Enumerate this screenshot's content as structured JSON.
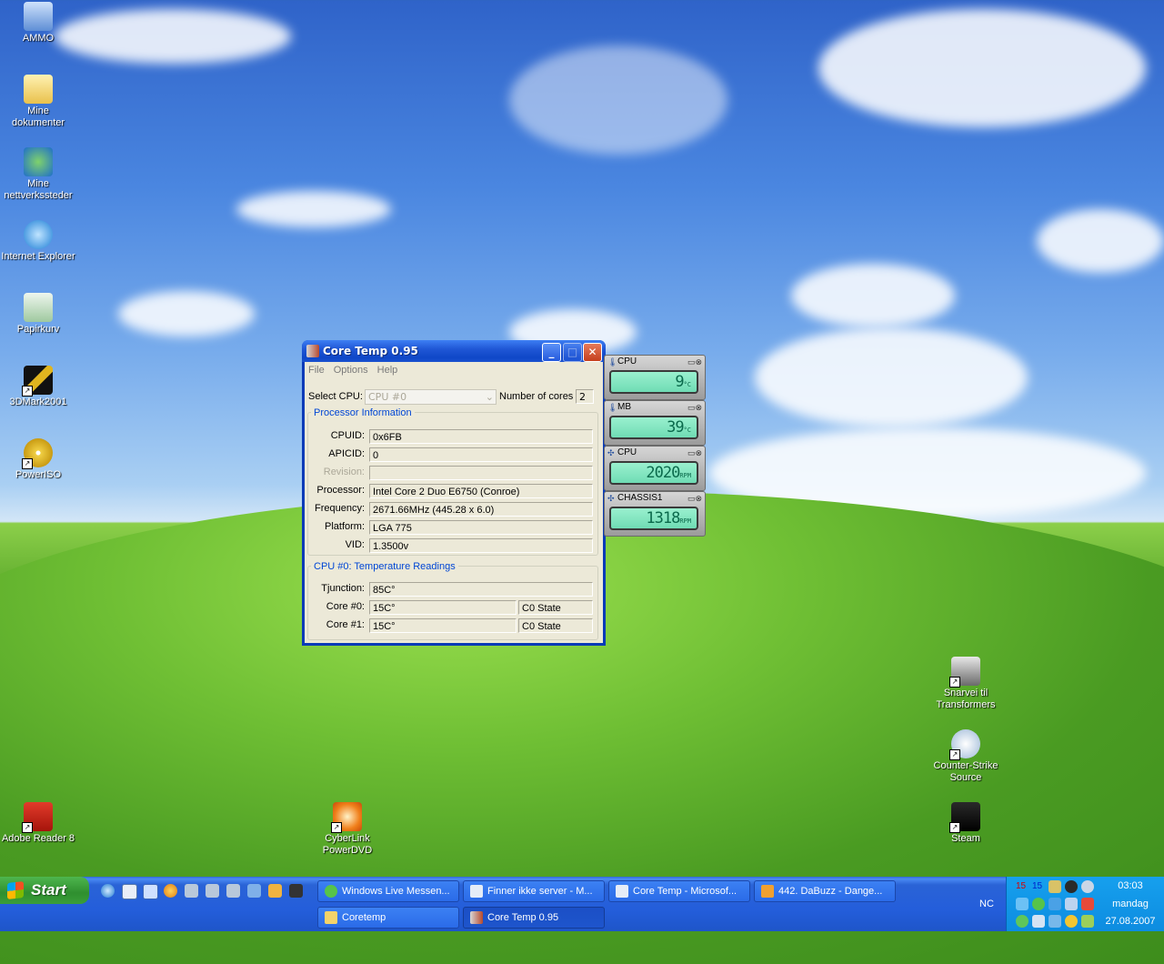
{
  "desktop": {
    "icons_left": [
      {
        "label": "AMMO"
      },
      {
        "label": "Mine dokumenter"
      },
      {
        "label": "Mine nettverkssteder"
      },
      {
        "label": "Internet Explorer"
      },
      {
        "label": "Papirkurv"
      },
      {
        "label": "3DMark2001"
      },
      {
        "label": "PowerISO"
      },
      {
        "label": "Adobe Reader 8"
      }
    ],
    "icon_cyberlink": "CyberLink PowerDVD",
    "icons_right": [
      {
        "label": "Snarvei til Transformers"
      },
      {
        "label": "Counter-Strike Source"
      },
      {
        "label": "Steam"
      }
    ]
  },
  "window": {
    "title": "Core Temp 0.95",
    "menu": [
      "File",
      "Options",
      "Help"
    ],
    "select_cpu_label": "Select CPU:",
    "select_cpu_value": "CPU #0",
    "num_cores_label": "Number of cores",
    "num_cores_value": "2",
    "proc_group_title": "Processor Information",
    "fields": [
      {
        "label": "CPUID:",
        "value": "0x6FB"
      },
      {
        "label": "APICID:",
        "value": "0"
      },
      {
        "label": "Revision:",
        "value": ""
      },
      {
        "label": "Processor:",
        "value": "Intel Core 2 Duo E6750 (Conroe)"
      },
      {
        "label": "Frequency:",
        "value": "2671.66MHz (445.28 x 6.0)"
      },
      {
        "label": "Platform:",
        "value": "LGA 775"
      },
      {
        "label": "VID:",
        "value": "1.3500v"
      }
    ],
    "temp_group_title": "CPU #0: Temperature Readings",
    "tjunction_label": "Tjunction:",
    "tjunction_value": "85C°",
    "cores": [
      {
        "label": "Core #0:",
        "temp": "15C°",
        "state": "C0 State"
      },
      {
        "label": "Core #1:",
        "temp": "15C°",
        "state": "C0 State"
      }
    ]
  },
  "gadgets": [
    {
      "name": "CPU",
      "value": "9",
      "unit": "°C"
    },
    {
      "name": "MB",
      "value": "39",
      "unit": "°C"
    },
    {
      "name": "CPU",
      "value": "2020",
      "unit": "RPM"
    },
    {
      "name": "CHASSIS1",
      "value": "1318",
      "unit": "RPM"
    }
  ],
  "taskbar": {
    "start_label": "Start",
    "tasks_row1": [
      "Windows Live Messen...",
      "Finner ikke server - M...",
      "Core Temp - Microsof...",
      "442. DaBuzz - Dange..."
    ],
    "tasks_row2": [
      "Coretemp",
      "Core Temp 0.95"
    ],
    "nc_label": "NC",
    "tray_temps": [
      "15",
      "15"
    ],
    "clock_time": "03:03",
    "clock_day": "mandag",
    "clock_date": "27.08.2007"
  }
}
